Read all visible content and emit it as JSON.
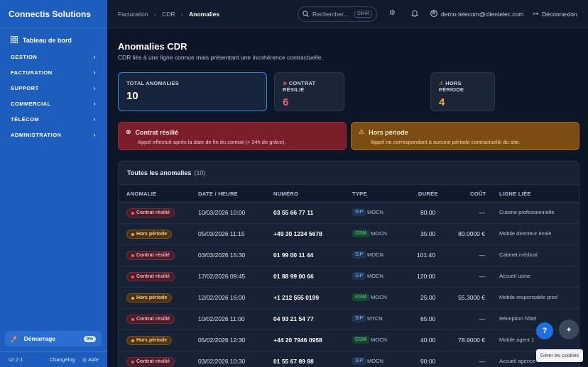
{
  "sidebar": {
    "brand": "Connectis Solutions",
    "dashboard": "Tableau de bord",
    "sections": [
      "GESTION",
      "FACTURATION",
      "SUPPORT",
      "COMMERCIAL",
      "TÉLÉCOM",
      "ADMINISTRATION"
    ],
    "start_label": "Démarrage",
    "start_progress": "0%",
    "version": "v2.2.1",
    "changelog": "Changelog",
    "help": "Aide"
  },
  "topbar": {
    "breadcrumb": [
      "Facturation",
      "CDR",
      "Anomalies"
    ],
    "search_placeholder": "Rechercher...",
    "search_shortcut": "Ctrl+K",
    "user_email": "demo-telecom@clientelec.com",
    "logout": "Déconnexion"
  },
  "page": {
    "title": "Anomalies CDR",
    "subtitle": "CDR liés à une ligne connue mais présentant une incohérence contractuelle."
  },
  "stats": {
    "total_label": "TOTAL ANOMALIES",
    "total_value": "10",
    "resilie_label": "CONTRAT RÉSILIÉ",
    "resilie_value": "6",
    "hors_label": "HORS PÉRIODE",
    "hors_value": "4"
  },
  "alerts": {
    "resilie_title": "Contrat résilié",
    "resilie_desc": "Appel effectué après la date de fin du contrat (+ 24h de grâce).",
    "hors_title": "Hors période",
    "hors_desc": "Appel ne correspondant à aucune période contractuelle du site."
  },
  "table": {
    "title": "Toutes les anomalies",
    "count": "(10)",
    "headers": [
      "ANOMALIE",
      "DATE / HEURE",
      "NUMÉRO",
      "TYPE",
      "DURÉE",
      "COÛT",
      "LIGNE LIÉE"
    ],
    "rows": [
      {
        "anomaly": "Contrat résilié",
        "kind": "res",
        "date": "10/03/2026 10:00",
        "number": "03 55 66 77 11",
        "tech": "SIP",
        "type": "MOCN",
        "duration": "80:00",
        "cost": "—",
        "line": "Cuisine professionnelle"
      },
      {
        "anomaly": "Hors période",
        "kind": "hp",
        "date": "05/03/2026 11:15",
        "number": "+49 30 1234 5678",
        "tech": "GSM",
        "type": "MOCN",
        "duration": "35:00",
        "cost": "80.0000 €",
        "line": "Mobile directeur école"
      },
      {
        "anomaly": "Contrat résilié",
        "kind": "res",
        "date": "03/03/2026 15:30",
        "number": "01 99 00 11 44",
        "tech": "SIP",
        "type": "MOCN",
        "duration": "101:40",
        "cost": "—",
        "line": "Cabinet médical"
      },
      {
        "anomaly": "Contrat résilié",
        "kind": "res",
        "date": "17/02/2026 09:45",
        "number": "01 88 99 00 66",
        "tech": "SIP",
        "type": "MOCN",
        "duration": "120:00",
        "cost": "—",
        "line": "Accueil usine"
      },
      {
        "anomaly": "Hors période",
        "kind": "hp",
        "date": "12/02/2026 16:00",
        "number": "+1 212 555 0199",
        "tech": "GSM",
        "type": "MOCN",
        "duration": "25:00",
        "cost": "55.3000 €",
        "line": "Mobile responsable prod"
      },
      {
        "anomaly": "Contrat résilié",
        "kind": "res",
        "date": "10/02/2026 11:00",
        "number": "04 93 21 54 77",
        "tech": "SIP",
        "type": "MTCN",
        "duration": "65:00",
        "cost": "—",
        "line": "Réception hôtel"
      },
      {
        "anomaly": "Hors période",
        "kind": "hp",
        "date": "05/02/2026 12:30",
        "number": "+44 20 7946 0958",
        "tech": "GSM",
        "type": "MOCN",
        "duration": "40:00",
        "cost": "78.9000 €",
        "line": "Mobile agent 1"
      },
      {
        "anomaly": "Contrat résilié",
        "kind": "res",
        "date": "03/02/2026 10:30",
        "number": "01 55 67 89 88",
        "tech": "SIP",
        "type": "MOCN",
        "duration": "90:00",
        "cost": "—",
        "line": "Accueil agence"
      }
    ]
  },
  "cookies": "Gérer les cookies"
}
